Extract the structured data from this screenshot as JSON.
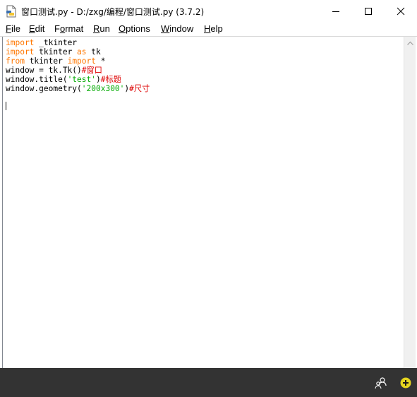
{
  "window": {
    "title": "窗口测试.py - D:/zxg/编程/窗口测试.py (3.7.2)",
    "icon": "python-file-icon",
    "controls": [
      "minimize-icon",
      "maximize-icon",
      "close-icon"
    ]
  },
  "menu": [
    {
      "mnemonic": "F",
      "rest": "ile"
    },
    {
      "mnemonic": "E",
      "rest": "dit"
    },
    {
      "pre": "F",
      "mnemonic": "o",
      "rest": "rmat"
    },
    {
      "mnemonic": "R",
      "rest": "un"
    },
    {
      "mnemonic": "O",
      "rest": "ptions"
    },
    {
      "mnemonic": "W",
      "rest": "indow"
    },
    {
      "mnemonic": "H",
      "rest": "elp"
    }
  ],
  "code": {
    "line1": {
      "kw": "import",
      "rest": " _tkinter"
    },
    "line2": {
      "kw": "import",
      "mid": " tkinter ",
      "kw2": "as",
      "rest": " tk"
    },
    "line3": {
      "kw": "from",
      "mid": " tkinter ",
      "kw2": "import",
      "rest": " *"
    },
    "line4": {
      "text": "window = tk.Tk()",
      "comment": "#窗口"
    },
    "line5": {
      "text": "window.title(",
      "str": "'test'",
      "text2": ")",
      "comment": "#标题"
    },
    "line6": {
      "text": "window.geometry(",
      "str": "'200x300'",
      "text2": ")",
      "comment": "#尺寸"
    }
  },
  "syntax_colors": {
    "keyword": "#ff7700",
    "string": "#00aa00",
    "comment": "#dd0000"
  },
  "taskbar": {
    "tray_icons": [
      "people-icon",
      "add-badge-icon"
    ],
    "background": "#333333"
  }
}
